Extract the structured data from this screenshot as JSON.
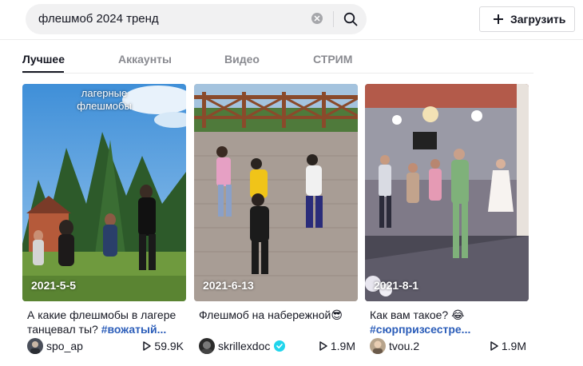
{
  "search": {
    "query": "флешмоб 2024 тренд"
  },
  "header": {
    "upload_label": "Загрузить"
  },
  "tabs": [
    {
      "label": "Лучшее"
    },
    {
      "label": "Аккаунты"
    },
    {
      "label": "Видео"
    },
    {
      "label": "СТРИМ"
    }
  ],
  "videos": [
    {
      "date": "2021-5-5",
      "overlay_text": "лагерные\nфлешмобы",
      "desc_text": "А какие флешмобы в лагере танцевал ты? ",
      "desc_hashtag": "#вожатый...",
      "username": "spo_ap",
      "views": "59.9K"
    },
    {
      "date": "2021-6-13",
      "desc_text": "Флешмоб на набережной😎",
      "username": "skrillexdoc",
      "views": "1.9M"
    },
    {
      "date": "2021-8-1",
      "desc_text": "Как вам такое? 😂",
      "desc_hashtag": "#сюрпризсестре...",
      "username": "tvou.2",
      "views": "1.9M"
    }
  ],
  "icons": {
    "clear": "clear-icon",
    "search": "search-icon",
    "upload": "plus-icon",
    "verified": "verified-badge-icon",
    "views": "play-icon"
  }
}
